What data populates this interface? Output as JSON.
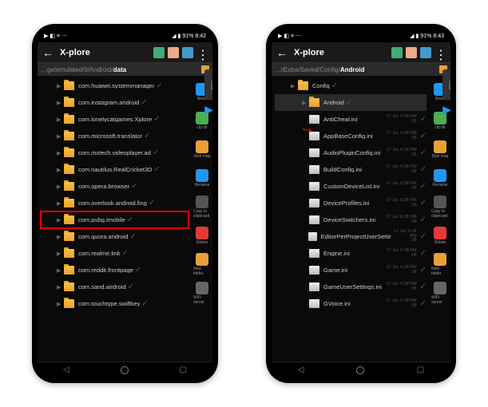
{
  "status": {
    "time_left": "8:42",
    "time_right": "8:43",
    "battery": "91%"
  },
  "app_title": "X-plore",
  "phones": [
    {
      "breadcrumb_prefix": "…ge/emulated/0/Android/",
      "breadcrumb_last": "data",
      "right_tab": "Root",
      "rows": [
        {
          "label": "com.huawei.systemmanager",
          "type": "folder"
        },
        {
          "label": "com.instagram.android",
          "type": "folder"
        },
        {
          "label": "com.lonelycatgames.Xplore",
          "type": "folder"
        },
        {
          "label": "com.microsoft.translator",
          "type": "folder"
        },
        {
          "label": "com.mxtech.videoplayer.ad",
          "type": "folder"
        },
        {
          "label": "com.nautilus.RealCricket3D",
          "type": "folder"
        },
        {
          "label": "com.opera.browser",
          "type": "folder"
        },
        {
          "label": "com.overlook.android.fing",
          "type": "folder"
        },
        {
          "label": "com.pubg.imobile",
          "type": "folder",
          "hl": true
        },
        {
          "label": "com.quora.android",
          "type": "folder"
        },
        {
          "label": "com.realme.link",
          "type": "folder"
        },
        {
          "label": "com.reddit.frontpage",
          "type": "folder"
        },
        {
          "label": "com.sand.airdroid",
          "type": "folder"
        },
        {
          "label": "com.touchtype.swiftkey",
          "type": "folder"
        }
      ],
      "tools": [
        {
          "label": "News",
          "color": "#2196f3"
        },
        {
          "label": "Up dir",
          "color": "#4caf50"
        },
        {
          "label": "Disk map",
          "color": "#e8a038"
        },
        {
          "label": "Rename",
          "color": "#2196f3"
        },
        {
          "label": "Copy to clipboard",
          "color": "#555"
        },
        {
          "label": "Delete",
          "color": "#e53935"
        },
        {
          "label": "New folder",
          "color": "#e8a038"
        },
        {
          "label": "WiFi server",
          "color": "#666"
        }
      ],
      "has_red_arrow": false
    },
    {
      "breadcrumb_prefix": "…rExtra/Saved/Config/",
      "breadcrumb_last": "Android",
      "right_tab": "Root",
      "rows": [
        {
          "label": "Config",
          "type": "folder",
          "indent": 1
        },
        {
          "label": "Android",
          "type": "folder",
          "indent": 2,
          "selected": true
        },
        {
          "label": "AntiCheat.ini",
          "type": "file",
          "indent": 2,
          "meta_date": "17 Jul, 6:38 PM",
          "meta_size": "1B"
        },
        {
          "label": "AppBaseConfig.ini",
          "type": "file",
          "indent": 2,
          "meta_date": "17 Jul, 6:38 PM",
          "meta_size": "1B"
        },
        {
          "label": "AudioPluginConfig.ini",
          "type": "file",
          "indent": 2,
          "meta_date": "17 Jul, 6:38 PM",
          "meta_size": "1B"
        },
        {
          "label": "BuildConfig.ini",
          "type": "file",
          "indent": 2,
          "meta_date": "17 Jul, 6:38 PM",
          "meta_size": "1B"
        },
        {
          "label": "CustomDeviceList.ini",
          "type": "file",
          "indent": 2,
          "meta_date": "17 Jul, 6:38 PM",
          "meta_size": "1B"
        },
        {
          "label": "DeviceProfiles.ini",
          "type": "file",
          "indent": 2,
          "meta_date": "17 Jul, 6:38 PM",
          "meta_size": "1B"
        },
        {
          "label": "DeviceSwitchers.ini",
          "type": "file",
          "indent": 2,
          "meta_date": "17 Jul, 6:38 PM",
          "meta_size": "1B"
        },
        {
          "label": "EditorPerProjectUserSettings.ini",
          "type": "file",
          "indent": 2,
          "meta_date": "17 Jul, 6:38 PM",
          "meta_size": "1B"
        },
        {
          "label": "Engine.ini",
          "type": "file",
          "indent": 2,
          "meta_date": "17 Jul, 6:38 PM",
          "meta_size": "1B"
        },
        {
          "label": "Game.ini",
          "type": "file",
          "indent": 2,
          "meta_date": "17 Jul, 6:38 PM",
          "meta_size": "1B"
        },
        {
          "label": "GameUserSettings.ini",
          "type": "file",
          "indent": 2,
          "meta_date": "17 Jul, 6:38 PM",
          "meta_size": "1B"
        },
        {
          "label": "GVoice.ini",
          "type": "file",
          "indent": 2,
          "meta_date": "17 Jul, 6:38 PM",
          "meta_size": "1B"
        }
      ],
      "tools": [
        {
          "label": "News",
          "color": "#2196f3"
        },
        {
          "label": "Up dir",
          "color": "#4caf50"
        },
        {
          "label": "Disk map",
          "color": "#e8a038"
        },
        {
          "label": "Rename",
          "color": "#2196f3"
        },
        {
          "label": "Copy to clipboard",
          "color": "#555"
        },
        {
          "label": "Delete",
          "color": "#e53935"
        },
        {
          "label": "New folder",
          "color": "#e8a038"
        },
        {
          "label": "WiFi server",
          "color": "#666"
        }
      ],
      "has_red_arrow": true
    }
  ]
}
